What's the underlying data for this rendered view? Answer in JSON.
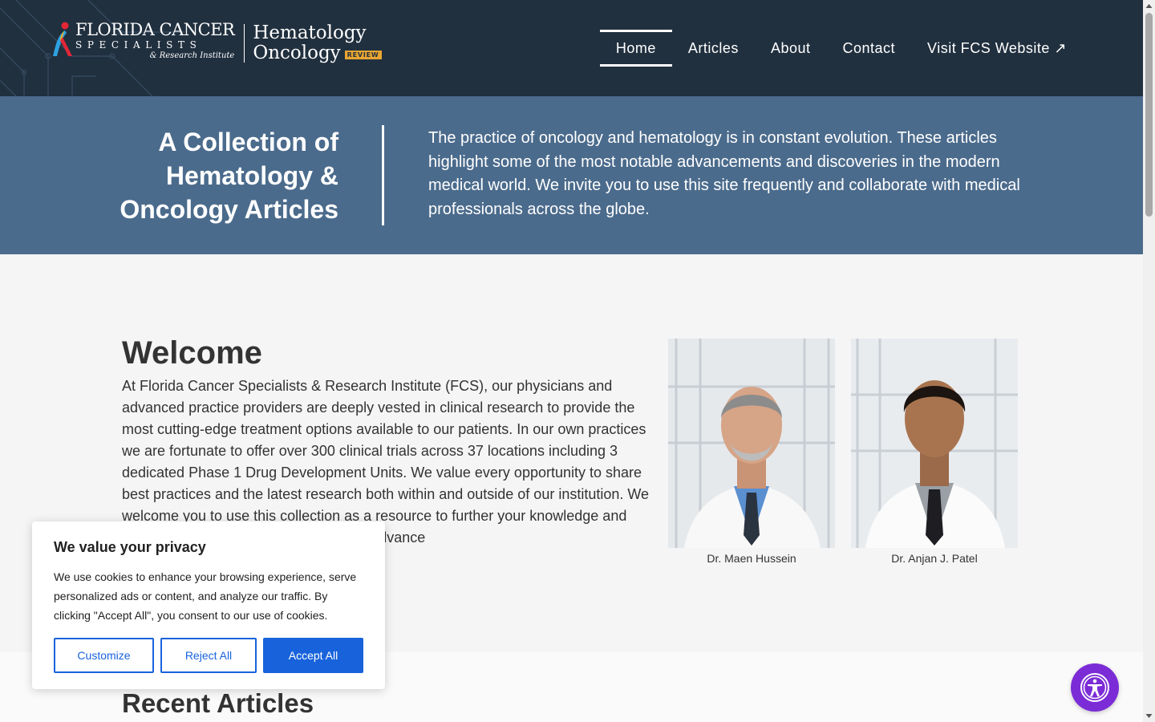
{
  "header": {
    "logo_fcs_line1": "FLORIDA CANCER",
    "logo_fcs_line2": "SPECIALISTS",
    "logo_fcs_line3": "& Research Institute",
    "logo_ho_line1": "Hematology",
    "logo_ho_line2": "Oncology",
    "logo_review": "REVIEW"
  },
  "nav": {
    "items": [
      {
        "label": "Home",
        "active": true
      },
      {
        "label": "Articles"
      },
      {
        "label": "About"
      },
      {
        "label": "Contact"
      },
      {
        "label": "Visit FCS Website ↗"
      }
    ]
  },
  "hero": {
    "title": "A Collection of Hematology & Oncology Articles",
    "text": "The practice of oncology and hematology is in constant evolution. These articles highlight some of the most notable advancements and discoveries in the modern medical world. We invite you to use this site frequently and collaborate with medical professionals across the globe."
  },
  "welcome": {
    "title": "Welcome",
    "text": "At Florida Cancer Specialists & Research Institute (FCS), our physicians and advanced practice providers are deeply vested in clinical research to provide the most cutting-edge treatment options available to our patients. In our own practices we are fortunate to offer over 300 clinical trials across 37 locations including 3 dedicated Phase 1 Drug Development Units. We value every opportunity to share best practices and the latest research both within and outside of our institution. We welcome you to use this collection as a resource to further your knowledge and understanding as we strive together to advance"
  },
  "doctors": [
    {
      "name": "Dr. Maen Hussein"
    },
    {
      "name": "Dr. Anjan J. Patel"
    }
  ],
  "recent": {
    "title": "Recent Articles"
  },
  "cookie": {
    "title": "We value your privacy",
    "text": "We use cookies to enhance your browsing experience, serve personalized ads or content, and analyze our traffic. By clicking \"Accept All\", you consent to our use of cookies.",
    "customize": "Customize",
    "reject": "Reject All",
    "accept": "Accept All"
  },
  "colors": {
    "header_bg": "#21303f",
    "hero_bg": "#4b6b8c",
    "cookie_accent": "#1863dc",
    "a11y_bg": "#7b2cd6"
  },
  "icons": {
    "logo": "ribbon-logo-icon",
    "accessibility": "accessibility-person-icon"
  }
}
